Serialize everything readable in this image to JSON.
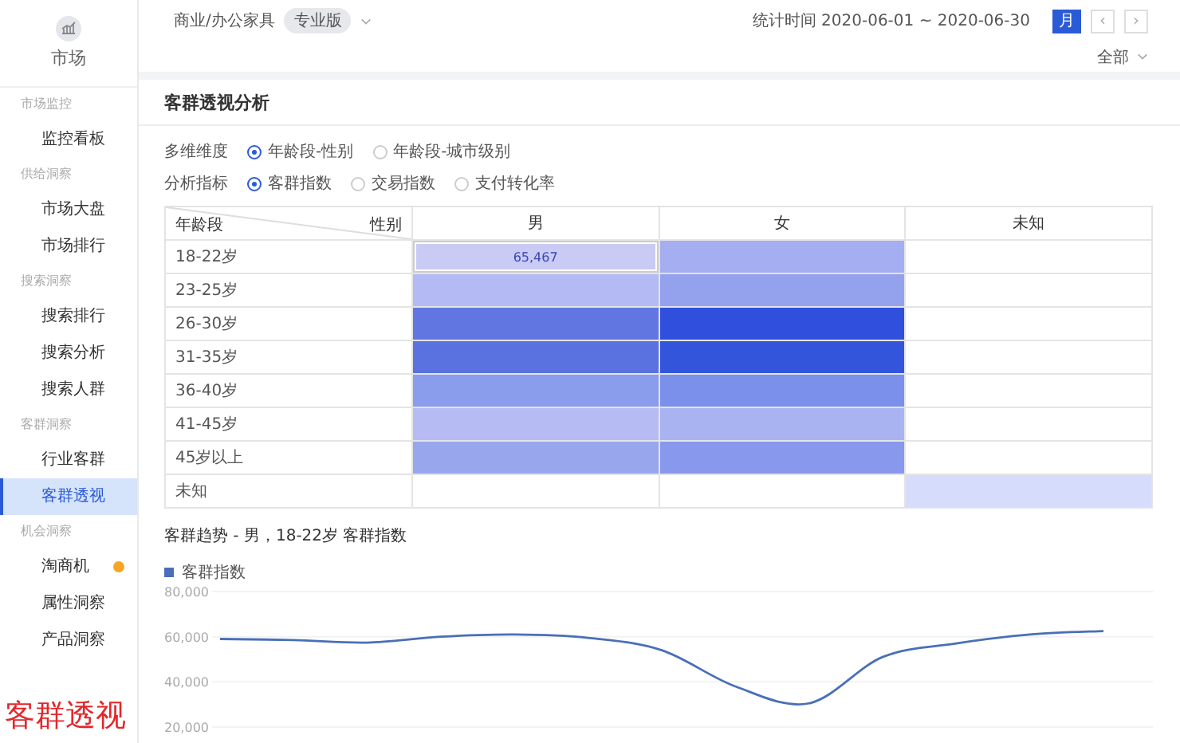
{
  "sidebar": {
    "title": "市场",
    "groups": [
      {
        "heading": "市场监控",
        "items": [
          {
            "label": "监控看板",
            "selected": false,
            "dot": false
          }
        ]
      },
      {
        "heading": "供给洞察",
        "items": [
          {
            "label": "市场大盘",
            "selected": false,
            "dot": false
          },
          {
            "label": "市场排行",
            "selected": false,
            "dot": false
          }
        ]
      },
      {
        "heading": "搜索洞察",
        "items": [
          {
            "label": "搜索排行",
            "selected": false,
            "dot": false
          },
          {
            "label": "搜索分析",
            "selected": false,
            "dot": false
          },
          {
            "label": "搜索人群",
            "selected": false,
            "dot": false
          }
        ]
      },
      {
        "heading": "客群洞察",
        "items": [
          {
            "label": "行业客群",
            "selected": false,
            "dot": false
          },
          {
            "label": "客群透视",
            "selected": true,
            "dot": false
          }
        ]
      },
      {
        "heading": "机会洞察",
        "items": [
          {
            "label": "淘商机",
            "selected": false,
            "dot": true
          },
          {
            "label": "属性洞察",
            "selected": false,
            "dot": false
          },
          {
            "label": "产品洞察",
            "selected": false,
            "dot": false
          }
        ]
      }
    ],
    "caption": "客群透视"
  },
  "topbar": {
    "category": "商业/办公家具",
    "tag": "专业版",
    "period_label": "统计时间 2020-06-01 ~ 2020-06-30",
    "period_buttons": [
      {
        "label": "月",
        "selected": true
      }
    ],
    "prev": "‹",
    "next": "›",
    "filter": "全部"
  },
  "panel": {
    "title": "客群透视分析",
    "filters": [
      {
        "label": "多维维度",
        "options": [
          {
            "label": "年龄段-性别",
            "selected": true
          },
          {
            "label": "年龄段-城市级别",
            "selected": false
          }
        ]
      },
      {
        "label": "分析指标",
        "options": [
          {
            "label": "客群指数",
            "selected": true
          },
          {
            "label": "交易指数",
            "selected": false
          },
          {
            "label": "支付转化率",
            "selected": false
          }
        ]
      }
    ],
    "table": {
      "corner_row": "年龄段",
      "corner_col": "性别",
      "columns": [
        "男",
        "女",
        "未知"
      ],
      "rows": [
        {
          "label": "18-22岁",
          "cells": [
            {
              "color": "#c9cbf5",
              "value": "65,467",
              "selected": true
            },
            {
              "color": "#a4aef0",
              "selected": false
            },
            {}
          ]
        },
        {
          "label": "23-25岁",
          "cells": [
            {
              "color": "#b4baf3",
              "selected": false
            },
            {
              "color": "#94a2ee",
              "selected": false
            },
            {}
          ]
        },
        {
          "label": "26-30岁",
          "cells": [
            {
              "color": "#6176e0",
              "selected": false
            },
            {
              "color": "#2f4fdc",
              "selected": false
            },
            {}
          ]
        },
        {
          "label": "31-35岁",
          "cells": [
            {
              "color": "#5a72e0",
              "selected": false
            },
            {
              "color": "#3355dc",
              "selected": false
            },
            {}
          ]
        },
        {
          "label": "36-40岁",
          "cells": [
            {
              "color": "#8a9cec",
              "selected": false
            },
            {
              "color": "#7b90ea",
              "selected": false
            },
            {}
          ]
        },
        {
          "label": "41-45岁",
          "cells": [
            {
              "color": "#b6bcf3",
              "selected": false
            },
            {
              "color": "#a9b3f1",
              "selected": false
            },
            {}
          ]
        },
        {
          "label": "45岁以上",
          "cells": [
            {
              "color": "#98a6ee",
              "selected": false
            },
            {
              "color": "#8898ec",
              "selected": false
            },
            {}
          ]
        },
        {
          "label": "未知",
          "cells": [
            {},
            {},
            {
              "color": "#d6dcfb",
              "selected": false
            }
          ]
        }
      ]
    },
    "trend_title": "客群趋势 - 男，18-22岁 客群指数",
    "chart_data": {
      "type": "line",
      "ylim": [
        20000,
        80000
      ],
      "yticks": [
        {
          "value": 20000,
          "label": "20,000"
        },
        {
          "value": 40000,
          "label": "40,000"
        },
        {
          "value": 60000,
          "label": "60,000"
        },
        {
          "value": 80000,
          "label": "80,000"
        }
      ],
      "series": [
        {
          "name": "客群指数",
          "color": "#4a6fb8",
          "values": [
            59000,
            58500,
            57400,
            60000,
            61000,
            59500,
            54000,
            38000,
            30500,
            51000,
            57000,
            61000,
            62500
          ]
        }
      ]
    }
  }
}
